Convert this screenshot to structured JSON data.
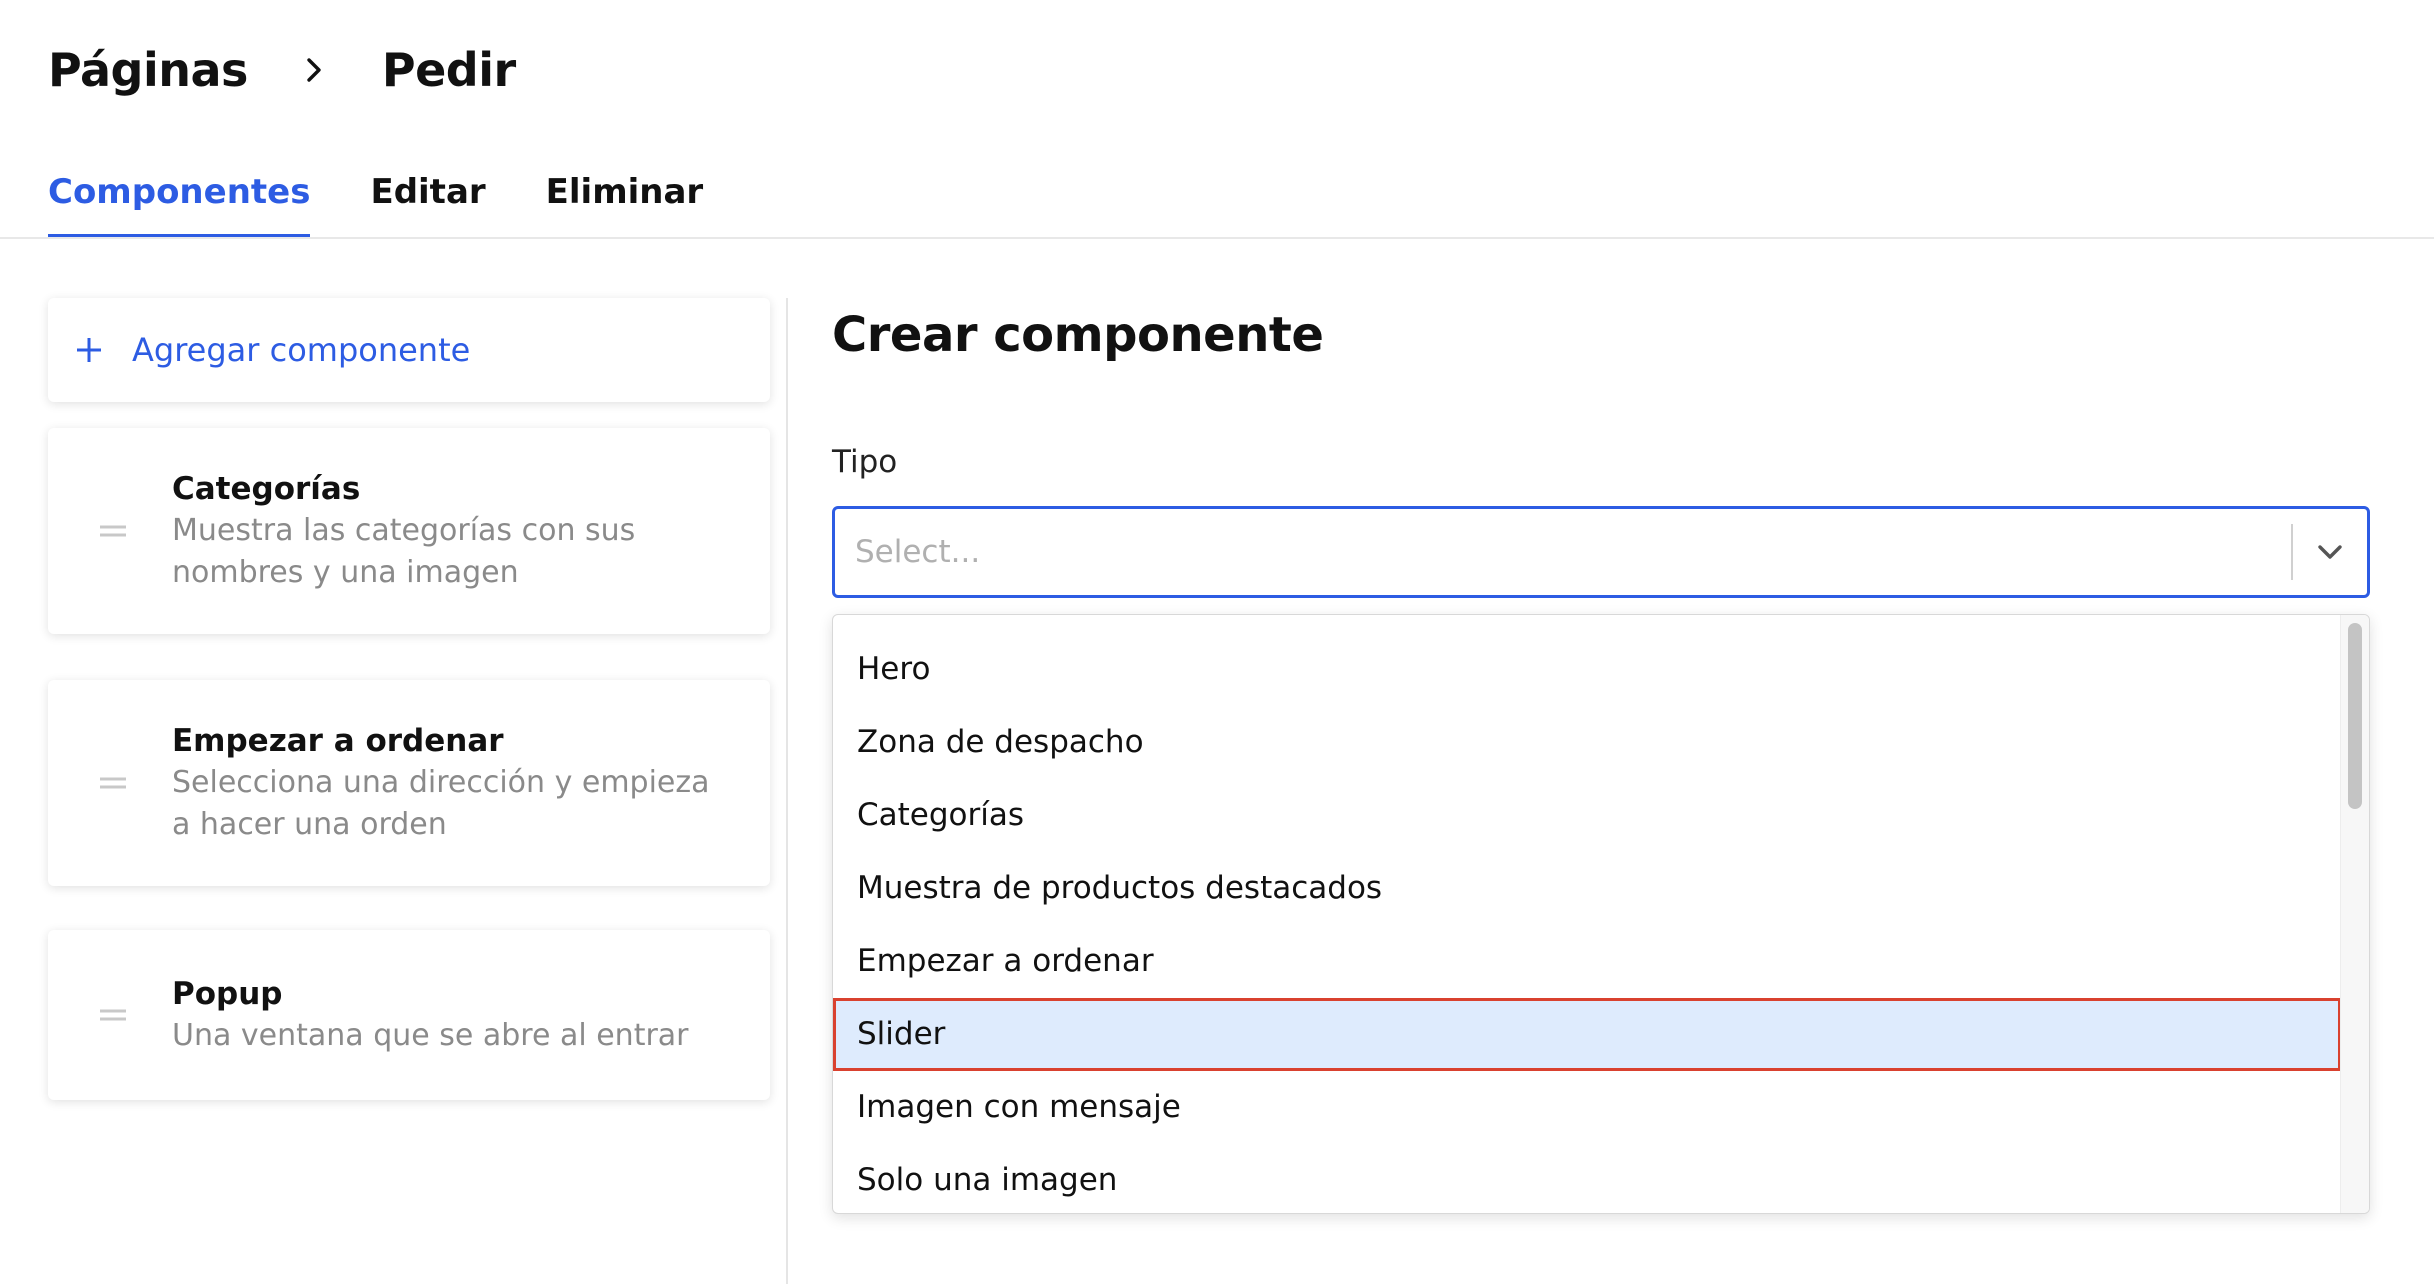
{
  "breadcrumb": {
    "parent": "Páginas",
    "current": "Pedir",
    "separator_icon": "chevron-right-icon"
  },
  "tabs": [
    {
      "label": "Componentes",
      "active": true
    },
    {
      "label": "Editar",
      "active": false
    },
    {
      "label": "Eliminar",
      "active": false
    }
  ],
  "sidebar": {
    "add_button": {
      "label": "Agregar componente",
      "icon": "plus-icon"
    },
    "components": [
      {
        "title": "Categorías",
        "description": "Muestra las categorías con sus nombres y una imagen"
      },
      {
        "title": "Empezar a ordenar",
        "description": "Selecciona una dirección y empieza a hacer una orden"
      },
      {
        "title": "Popup",
        "description": "Una ventana que se abre al entrar"
      }
    ]
  },
  "form": {
    "title": "Crear componente",
    "type_label": "Tipo",
    "type_placeholder": "Select...",
    "options": [
      "Hero",
      "Zona de despacho",
      "Categorías",
      "Muestra de productos destacados",
      "Empezar a ordenar",
      "Slider",
      "Imagen con mensaje",
      "Solo una imagen"
    ],
    "highlighted_option": "Slider"
  },
  "colors": {
    "accent": "#2d5ce3",
    "highlight_bg": "#deebfd",
    "highlight_outline": "#d9412f",
    "muted_text": "#8a8a8a"
  }
}
